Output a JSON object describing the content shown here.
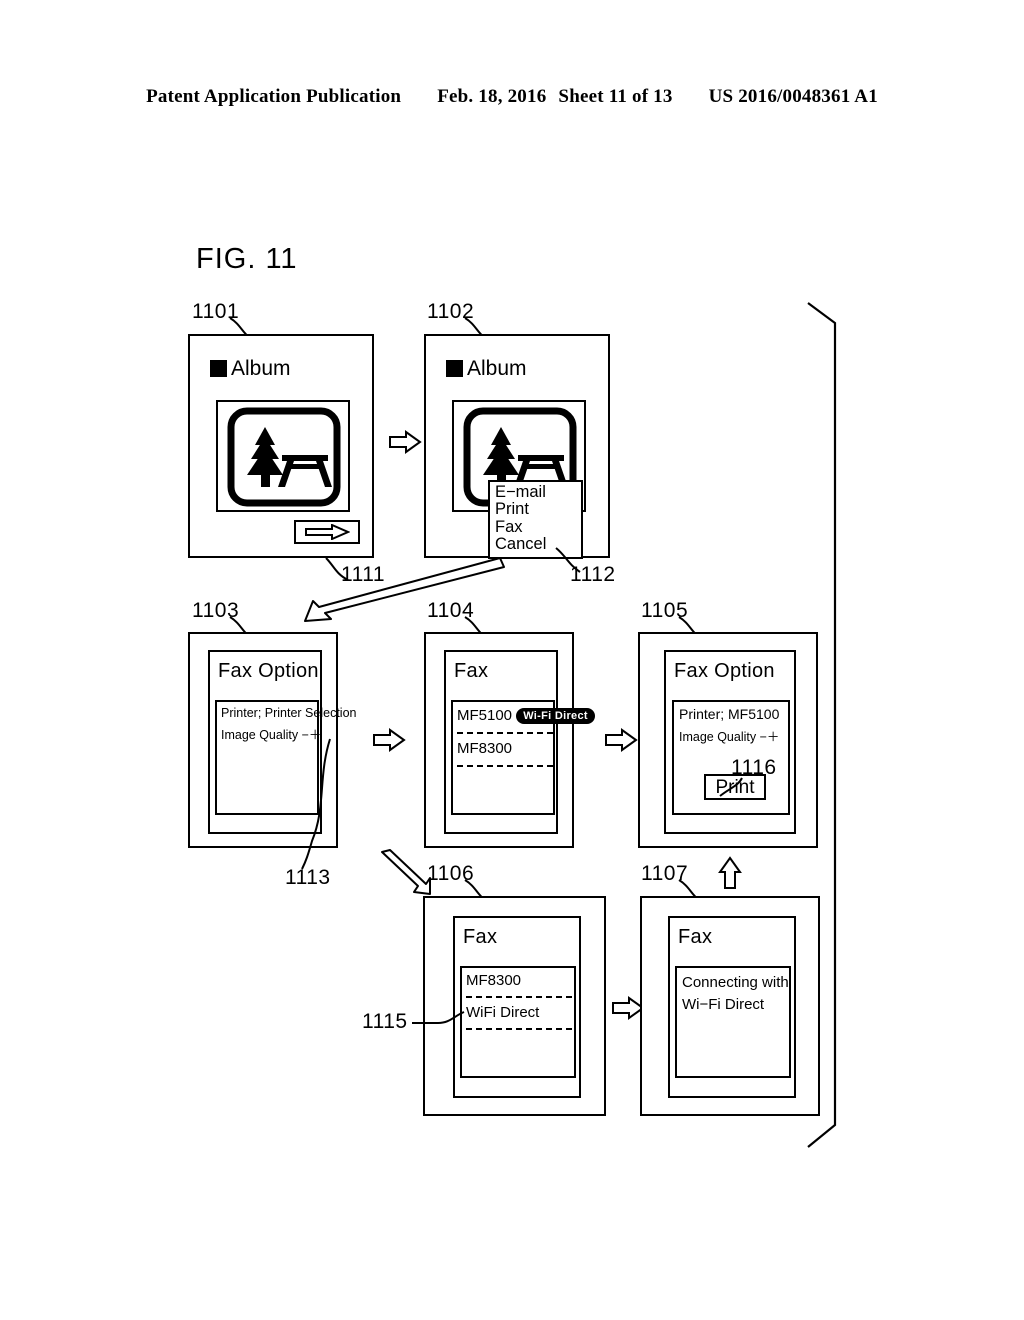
{
  "header": {
    "publication": "Patent Application Publication",
    "date": "Feb. 18, 2016",
    "sheet": "Sheet 11 of 13",
    "docnum": "US 2016/0048361 A1"
  },
  "figure": {
    "title": "FIG. 11"
  },
  "refs": {
    "r1101": "1101",
    "r1102": "1102",
    "r1103": "1103",
    "r1104": "1104",
    "r1105": "1105",
    "r1106": "1106",
    "r1107": "1107",
    "r1111": "1111",
    "r1112": "1112",
    "r1113": "1113",
    "r1115": "1115",
    "r1116": "1116"
  },
  "panels": {
    "p1101": {
      "ref": "1101",
      "app_title": "Album",
      "photo_icon": "campsite-picnic-icon",
      "next_button_icon": "right-arrow-icon"
    },
    "p1102": {
      "ref": "1102",
      "app_title": "Album",
      "photo_icon": "campsite-picnic-icon",
      "menu": [
        "E−mail",
        "Print",
        "Fax",
        "Cancel"
      ]
    },
    "p1103": {
      "ref": "1103",
      "screen_title": "Fax Option",
      "rows": [
        "Printer; Printer Selection",
        "Image Quality  −＋"
      ]
    },
    "p1104": {
      "ref": "1104",
      "screen_title": "Fax",
      "items": [
        {
          "name": "MF5100",
          "badge": "Wi-Fi  Direct"
        },
        {
          "name": "MF8300",
          "badge": ""
        }
      ]
    },
    "p1105": {
      "ref": "1105",
      "screen_title": "Fax Option",
      "rows": [
        "Printer; MF5100",
        "Image Quality  −＋"
      ],
      "print_button": "Print"
    },
    "p1106": {
      "ref": "1106",
      "screen_title": "Fax",
      "items": [
        "MF8300",
        "WiFi Direct"
      ]
    },
    "p1107": {
      "ref": "1107",
      "screen_title": "Fax",
      "message_line1": "Connecting with",
      "message_line2": "Wi−Fi Direct"
    }
  },
  "flow_arrows": [
    {
      "name": "arrow-1101-to-1102",
      "direction": "right"
    },
    {
      "name": "arrow-1102-to-1103",
      "direction": "down-left-long"
    },
    {
      "name": "arrow-1103-to-1104",
      "direction": "right"
    },
    {
      "name": "arrow-1104-to-1105",
      "direction": "right"
    },
    {
      "name": "arrow-1104-to-1106",
      "direction": "down-right"
    },
    {
      "name": "arrow-1106-to-1107",
      "direction": "right"
    },
    {
      "name": "arrow-1107-to-1105",
      "direction": "up"
    }
  ],
  "colors": {
    "ink": "#000000",
    "paper": "#ffffff",
    "badge_bg": "#000000",
    "badge_fg": "#ffffff"
  }
}
